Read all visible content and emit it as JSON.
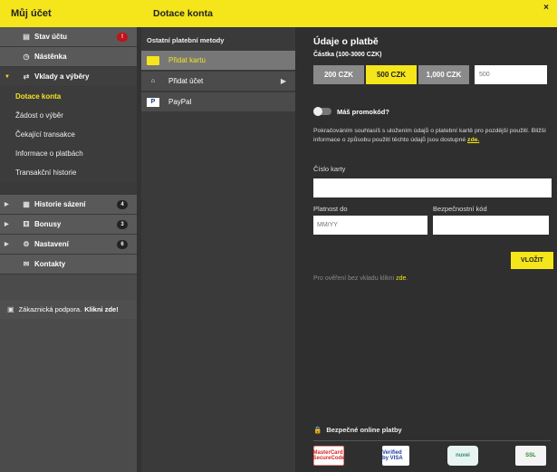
{
  "account": {
    "title": "Můj účet",
    "items_top": [
      {
        "label": "Stav účtu",
        "icon": "wallet-icon",
        "glyph": "▤",
        "badge": "!"
      },
      {
        "label": "Nástěnka",
        "icon": "dashboard-icon",
        "glyph": "◷"
      }
    ],
    "deposits_section": {
      "label": "Vklady a výběry",
      "glyph": "⇄"
    },
    "submenu": [
      "Dotace konta",
      "Žádost o výběr",
      "Čekající transakce",
      "Informace o platbách",
      "Transakční historie"
    ],
    "items_bottom": [
      {
        "label": "Historie sázení",
        "glyph": "▦",
        "badge": "4"
      },
      {
        "label": "Bonusy",
        "glyph": "⚅",
        "badge": "3"
      },
      {
        "label": "Nastavení",
        "glyph": "⚙",
        "badge": "6"
      }
    ],
    "contacts": {
      "label": "Kontakty",
      "glyph": "✉"
    },
    "support": {
      "text": "Zákaznická podpora.",
      "link": "Klikni zde!",
      "glyph": "▣"
    }
  },
  "deposit": {
    "title": "Dotace konta",
    "close": "×",
    "methods_title": "Ostatní platební metody",
    "methods": [
      {
        "label": "Přidat kartu",
        "glyph": "▬"
      },
      {
        "label": "Přidat účet",
        "glyph": "⌂"
      },
      {
        "label": "PayPal",
        "glyph": "P"
      }
    ],
    "chevron": "▶"
  },
  "payment": {
    "title": "Údaje o platbě",
    "amount_label": "Částka (100-3000 CZK)",
    "amounts": [
      "200 CZK",
      "500 CZK",
      "1,000 CZK"
    ],
    "selected_amount": "500 CZK",
    "amount_input": "500",
    "promo_label": "Máš promokód?",
    "consent": "Pokračováním souhlasíš s uložením údajů o platební kartě pro pozdější použití. Bližší informace o způsobu použití těchto údajů jsou dostupné",
    "consent_link": "zde.",
    "card_number_label": "Číslo karty",
    "expiry_label": "Platnost do",
    "expiry_placeholder": "MM/YY",
    "cvv_label": "Bezpečnostní kód",
    "submit": "VLOŽIT",
    "verify_text": "Pro ověření bez vkladu klikni",
    "verify_link": "zde",
    "verify_end": ".",
    "secure_label": "Bezpečné online platby",
    "logos": [
      "MasterCard SecureCode",
      "Verified by VISA",
      "nuvei",
      "SSL"
    ]
  },
  "colors": {
    "accent": "#f5e51b",
    "alert": "#c0121a"
  }
}
